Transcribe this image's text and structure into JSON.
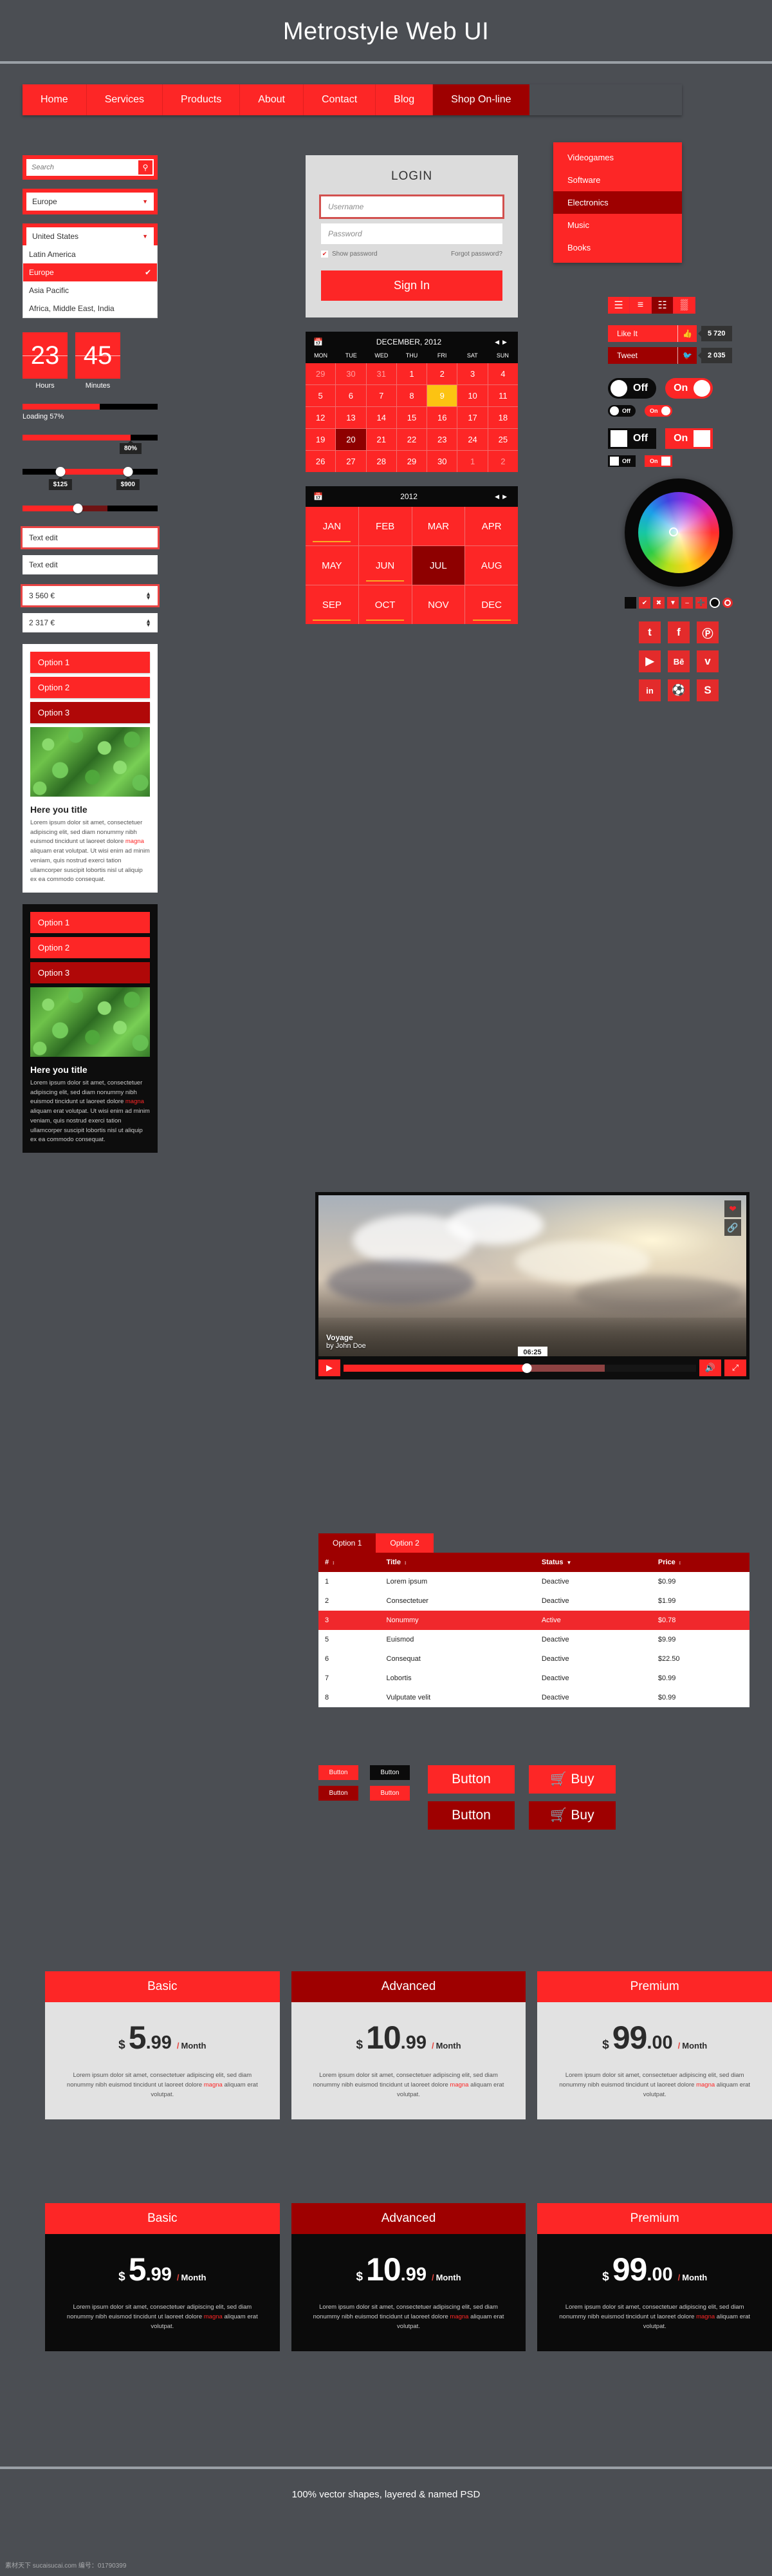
{
  "header": {
    "title": "Metrostyle Web UI"
  },
  "nav": {
    "items": [
      "Home",
      "Services",
      "Products",
      "About",
      "Contact",
      "Blog",
      "Shop On-line"
    ],
    "active": "Shop On-line",
    "submenu": [
      "Videogames",
      "Software",
      "Electronics",
      "Music",
      "Books"
    ],
    "submenu_active": "Electronics"
  },
  "search": {
    "placeholder": "Search",
    "icon": "search-icon"
  },
  "region_select": {
    "value": "Europe"
  },
  "region_dropdown": {
    "value": "United States",
    "options": [
      "Latin America",
      "Europe",
      "Asia Pacific",
      "Africa, Middle East, India"
    ],
    "selected": "Europe",
    "check": "✔"
  },
  "countdown": {
    "units": [
      {
        "value": "23",
        "label": "Hours"
      },
      {
        "value": "45",
        "label": "Minutes"
      }
    ]
  },
  "progress": {
    "value": 57,
    "label": "Loading 57%"
  },
  "progress2": {
    "value": 80,
    "tooltip": "80%"
  },
  "range": {
    "min_label": "$125",
    "max_label": "$900",
    "min_pct": 28,
    "max_pct": 78
  },
  "slider": {
    "value_pct": 41
  },
  "text_edits": [
    {
      "value": "Text edit",
      "focused": true
    },
    {
      "value": "Text edit",
      "focused": false
    }
  ],
  "spinners": [
    {
      "value": "3 560 €",
      "focused": true
    },
    {
      "value": "2 317 €",
      "focused": false
    }
  ],
  "accordion_light": {
    "options": [
      "Option 1",
      "Option 2",
      "Option 3"
    ],
    "active": "Option 3",
    "title": "Here you title",
    "text": "Lorem ipsum dolor sit amet, consectetuer adipiscing elit, sed diam nonummy nibh euismod tincidunt ut laoreet dolore magna aliquam erat volutpat. Ut wisi enim ad minim veniam, quis nostrud exerci tation ullamcorper suscipit lobortis nisl ut aliquip ex ea commodo consequat."
  },
  "accordion_dark": {
    "options": [
      "Option 1",
      "Option 2",
      "Option 3"
    ],
    "active": "Option 3",
    "title": "Here you title",
    "text": "Lorem ipsum dolor sit amet, consectetuer adipiscing elit, sed diam nonummy nibh euismod tincidunt ut laoreet dolore magna aliquam erat volutpat. Ut wisi enim ad minim veniam, quis nostrud exerci tation ullamcorper suscipit lobortis nisl ut aliquip ex ea commodo consequat."
  },
  "login": {
    "title": "LOGIN",
    "username_placeholder": "Username",
    "password_placeholder": "Password",
    "show_password": "Show password",
    "forgot": "Forgot password?",
    "submit": "Sign In"
  },
  "calendar": {
    "month_label": "DECEMBER, 2012",
    "dow": [
      "MON",
      "TUE",
      "WED",
      "THU",
      "FRI",
      "SAT",
      "SUN"
    ],
    "days": [
      {
        "d": "29",
        "muted": true
      },
      {
        "d": "30",
        "muted": true
      },
      {
        "d": "31",
        "muted": true
      },
      {
        "d": "1"
      },
      {
        "d": "2"
      },
      {
        "d": "3"
      },
      {
        "d": "4"
      },
      {
        "d": "5"
      },
      {
        "d": "6"
      },
      {
        "d": "7"
      },
      {
        "d": "8"
      },
      {
        "d": "9",
        "today": true
      },
      {
        "d": "10"
      },
      {
        "d": "11"
      },
      {
        "d": "12"
      },
      {
        "d": "13"
      },
      {
        "d": "14"
      },
      {
        "d": "15"
      },
      {
        "d": "16"
      },
      {
        "d": "17"
      },
      {
        "d": "18"
      },
      {
        "d": "19"
      },
      {
        "d": "20",
        "selected": true
      },
      {
        "d": "21"
      },
      {
        "d": "22"
      },
      {
        "d": "23"
      },
      {
        "d": "24"
      },
      {
        "d": "25"
      },
      {
        "d": "26"
      },
      {
        "d": "27"
      },
      {
        "d": "28"
      },
      {
        "d": "29"
      },
      {
        "d": "30"
      },
      {
        "d": "1",
        "muted": true
      },
      {
        "d": "2",
        "muted": true
      }
    ]
  },
  "year_picker": {
    "year_label": "2012",
    "months": [
      {
        "m": "JAN",
        "marked": true
      },
      {
        "m": "FEB"
      },
      {
        "m": "MAR"
      },
      {
        "m": "APR"
      },
      {
        "m": "MAY"
      },
      {
        "m": "JUN",
        "marked": true
      },
      {
        "m": "JUL",
        "selected": true
      },
      {
        "m": "AUG"
      },
      {
        "m": "SEP",
        "marked": true
      },
      {
        "m": "OCT",
        "marked": true
      },
      {
        "m": "NOV"
      },
      {
        "m": "DEC",
        "marked": true
      }
    ]
  },
  "view_switch": {
    "buttons": [
      "list-lines-icon",
      "bullet-list-icon",
      "detail-list-icon",
      "grid-icon"
    ],
    "active_index": 2
  },
  "social_cta": [
    {
      "label": "Like It",
      "icon": "thumbs-up-icon",
      "count": "5 720",
      "style": "red"
    },
    {
      "label": "Tweet",
      "icon": "twitter-bird-icon",
      "count": "2 035",
      "style": "dark"
    }
  ],
  "toggles": {
    "off_label": "Off",
    "on_label": "On"
  },
  "color_picker": {
    "swatches": [
      "black-swatch",
      "check-icon",
      "close-icon",
      "caret-down-icon",
      "minus-icon",
      "plus-icon",
      "radio-off",
      "radio-on"
    ]
  },
  "social_icons": [
    "twitter-icon",
    "facebook-icon",
    "pinterest-icon",
    "youtube-icon",
    "behance-icon",
    "vimeo-icon",
    "linkedin-icon",
    "dribbble-icon",
    "skype-icon"
  ],
  "video": {
    "title": "Voyage",
    "author": "by John Doe",
    "time": "06:25",
    "overlay_buttons": [
      "heart-icon",
      "link-icon"
    ],
    "controls": [
      "play-icon",
      "volume-icon",
      "fullscreen-icon"
    ],
    "progress_pct": 52
  },
  "table": {
    "tabs": [
      "Option 1",
      "Option 2"
    ],
    "active_tab": "Option 1",
    "columns": [
      "#",
      "Title",
      "Status",
      "Price"
    ],
    "rows": [
      {
        "num": "1",
        "title": "Lorem ipsum",
        "status": "Deactive",
        "price": "$0.99",
        "highlight": false
      },
      {
        "num": "2",
        "title": "Consectetuer",
        "status": "Deactive",
        "price": "$1.99",
        "highlight": false
      },
      {
        "num": "3",
        "title": "Nonummy",
        "status": "Active",
        "price": "$0.78",
        "highlight": true
      },
      {
        "num": "5",
        "title": "Euismod",
        "status": "Deactive",
        "price": "$9.99",
        "highlight": false
      },
      {
        "num": "6",
        "title": "Consequat",
        "status": "Deactive",
        "price": "$22.50",
        "highlight": false
      },
      {
        "num": "7",
        "title": "Lobortis",
        "status": "Deactive",
        "price": "$0.99",
        "highlight": false
      },
      {
        "num": "8",
        "title": "Vulputate velit",
        "status": "Deactive",
        "price": "$0.99",
        "highlight": false
      }
    ]
  },
  "buttons": {
    "small": [
      "Button",
      "Button",
      "Button",
      "Button"
    ],
    "large": [
      "Button",
      "Button"
    ],
    "buy": [
      "Buy",
      "Buy"
    ]
  },
  "pricing_light": [
    {
      "name": "Basic",
      "currency": "$",
      "int": "5",
      "dec": ".99",
      "per": "Month",
      "head_style": "red",
      "text": "Lorem ipsum dolor sit amet, consectetuer adipiscing elit, sed diam nonummy nibh euismod tincidunt ut laoreet dolore magna aliquam erat volutpat."
    },
    {
      "name": "Advanced",
      "currency": "$",
      "int": "10",
      "dec": ".99",
      "per": "Month",
      "head_style": "dark",
      "text": "Lorem ipsum dolor sit amet, consectetuer adipiscing elit, sed diam nonummy nibh euismod tincidunt ut laoreet dolore magna aliquam erat volutpat."
    },
    {
      "name": "Premium",
      "currency": "$",
      "int": "99",
      "dec": ".00",
      "per": "Month",
      "head_style": "red",
      "text": "Lorem ipsum dolor sit amet, consectetuer adipiscing elit, sed diam nonummy nibh euismod tincidunt ut laoreet dolore magna aliquam erat volutpat."
    }
  ],
  "pricing_dark": [
    {
      "name": "Basic",
      "currency": "$",
      "int": "5",
      "dec": ".99",
      "per": "Month",
      "head_style": "red",
      "text": "Lorem ipsum dolor sit amet, consectetuer adipiscing elit, sed diam nonummy nibh euismod tincidunt ut laoreet dolore magna aliquam erat volutpat."
    },
    {
      "name": "Advanced",
      "currency": "$",
      "int": "10",
      "dec": ".99",
      "per": "Month",
      "head_style": "dark",
      "text": "Lorem ipsum dolor sit amet, consectetuer adipiscing elit, sed diam nonummy nibh euismod tincidunt ut laoreet dolore magna aliquam erat volutpat."
    },
    {
      "name": "Premium",
      "currency": "$",
      "int": "99",
      "dec": ".00",
      "per": "Month",
      "head_style": "red",
      "text": "Lorem ipsum dolor sit amet, consectetuer adipiscing elit, sed diam nonummy nibh euismod tincidunt ut laoreet dolore magna aliquam erat volutpat."
    }
  ],
  "footer": {
    "note": "100% vector shapes, layered & named PSD",
    "watermark": "素材天下 sucaisucai.com 编号：01790399"
  },
  "colors": {
    "accent": "#fd2626",
    "accent_dark": "#9e0000",
    "bg": "#4b4e53",
    "today": "#fcc312"
  }
}
